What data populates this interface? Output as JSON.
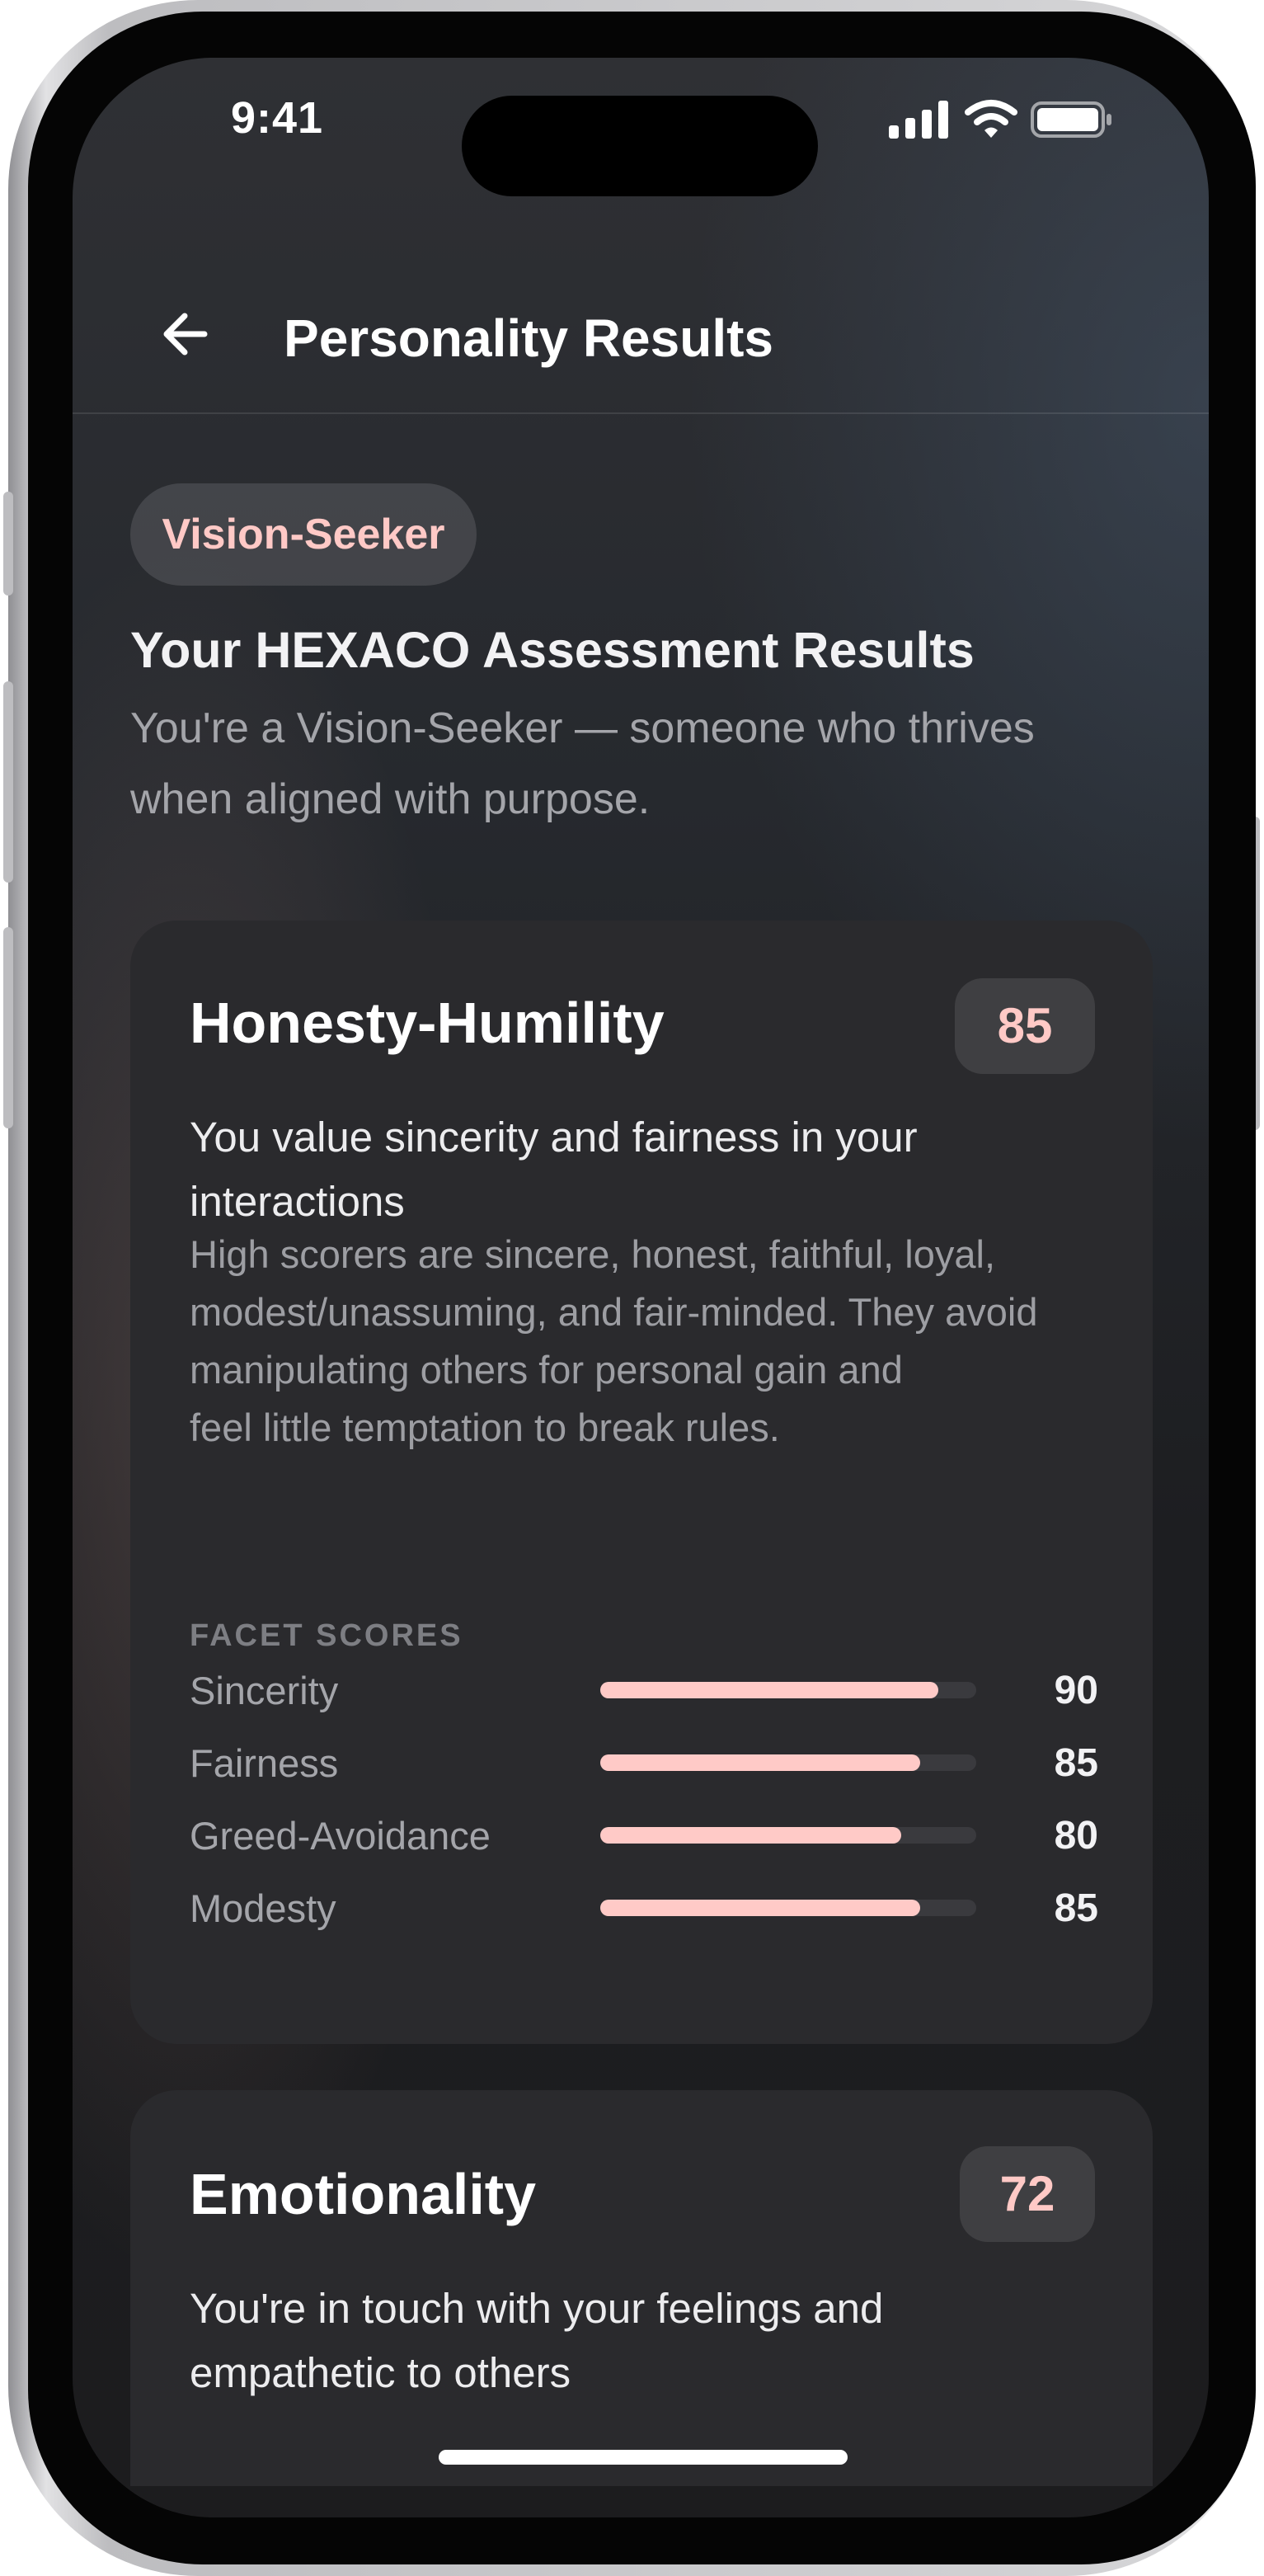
{
  "status_bar": {
    "time": "9:41"
  },
  "nav": {
    "title": "Personality Results"
  },
  "profile": {
    "type_badge": "Vision-Seeker",
    "headline": "Your HEXACO Assessment Results",
    "subline": "You're a Vision-Seeker — someone who thrives when aligned with purpose."
  },
  "cards": [
    {
      "title": "Honesty-Humility",
      "score": "85",
      "lead": "You value sincerity and fairness in your interactions",
      "description": "High scorers are sincere, honest, faithful, loyal, modest/unassuming, and fair-minded. They avoid manipulating others for personal gain and\nfeel little temptation to break rules.",
      "facet_heading": "FACET SCORES",
      "facets": [
        {
          "name": "Sincerity",
          "value": 90
        },
        {
          "name": "Fairness",
          "value": 85
        },
        {
          "name": "Greed-Avoidance",
          "value": 80
        },
        {
          "name": "Modesty",
          "value": 85
        }
      ]
    },
    {
      "title": "Emotionality",
      "score": "72",
      "lead": "You're in touch with your feelings and empathetic to others"
    }
  ],
  "icons": {
    "back": "arrow-left-icon",
    "signal": "cellular-signal-icon",
    "wifi": "wifi-icon",
    "battery": "battery-icon"
  },
  "colors": {
    "accent": "#ffc9c6",
    "card_bg": "#2a2a2d",
    "track_bg": "#3a3a3e"
  }
}
